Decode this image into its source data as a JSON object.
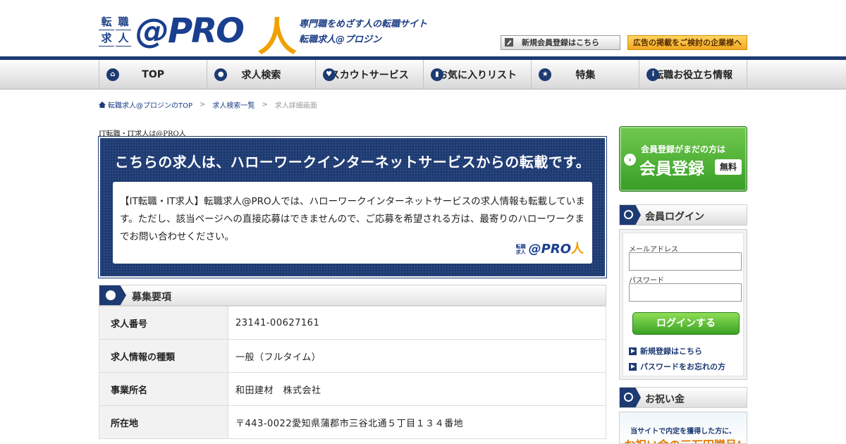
{
  "header": {
    "logo_kanji": [
      "転",
      "職",
      "求",
      "人"
    ],
    "logo_mark": "@PRO",
    "logo_person": "人",
    "tagline_1": "専門職をめざす人の転職サイト",
    "tagline_2": "転職求人@プロジン",
    "register_button": "新規会員登録はこちら",
    "ad_button": "広告の掲載をご検討の企業様へ"
  },
  "nav": {
    "items": [
      {
        "label": "TOP",
        "icon": "home-icon"
      },
      {
        "label": "求人検索",
        "icon": "search-icon"
      },
      {
        "label": "スカウトサービス",
        "icon": "heart-icon"
      },
      {
        "label": "お気に入りリスト",
        "icon": "bookmark-icon"
      },
      {
        "label": "特集",
        "icon": "star-icon"
      },
      {
        "label": "転職お役立ち情報",
        "icon": "info-icon"
      }
    ]
  },
  "breadcrumb": {
    "home": "転職求人@プロジンのTOP",
    "list": "求人検索一覧",
    "current": "求人詳細画面",
    "separator": ">"
  },
  "main": {
    "lead": "IT転職・IT求人は@PRO人",
    "notice_title": "こちらの求人は、ハローワークインターネットサービスからの転載です。",
    "notice_body": "【IT転職・IT求人】転職求人@PRO人では、ハローワークインターネットサービスの求人情報も転載しています。ただし、該当ページへの直接応募はできませんので、ご応募を希望される方は、最寄りのハローワークまでお問い合わせください。",
    "notice_logo_mark": "@PRO",
    "notice_logo_person": "人",
    "section_title": "募集要項",
    "rows": [
      {
        "label": "求人番号",
        "value": "23141-00627161"
      },
      {
        "label": "求人情報の種類",
        "value": "一般（フルタイム）"
      },
      {
        "label": "事業所名",
        "value": "和田建材　株式会社"
      },
      {
        "label": "所在地",
        "value": "〒443-0022愛知県蒲郡市三谷北通５丁目１３４番地"
      }
    ]
  },
  "sidebar": {
    "register_line1": "会員登録がまだの方は",
    "register_line2": "会員登録",
    "register_free": "無料",
    "login_title": "会員ログイン",
    "email_label": "メールアドレス",
    "password_label": "パスワード",
    "login_button": "ログインする",
    "link_register": "新規登録はこちら",
    "link_forgot": "パスワードをお忘れの方",
    "gift_title": "お祝い金",
    "gift_text": "当サイトで内定を獲得した方に、",
    "gift_text2": "お祝い金の三万円贈呈!"
  },
  "colors": {
    "brand_navy": "#1d3a72",
    "brand_orange": "#f0a000",
    "cta_green": "#3aa224"
  }
}
